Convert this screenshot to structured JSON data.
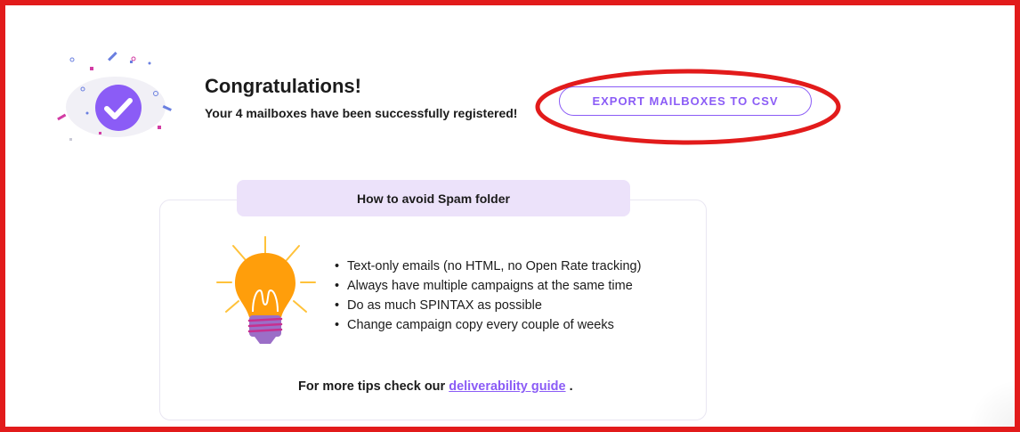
{
  "success": {
    "title": "Congratulations!",
    "subtitle": "Your 4 mailboxes have been successfully registered!",
    "icon": "check-circle-icon"
  },
  "export_button": {
    "label": "EXPORT MAILBOXES TO CSV"
  },
  "tips": {
    "heading": "How to avoid Spam folder",
    "icon": "lightbulb-icon",
    "items": [
      "Text-only emails (no HTML, no Open Rate tracking)",
      "Always have multiple campaigns at the same time",
      "Do as much SPINTAX as possible",
      "Change campaign copy every couple of weeks"
    ],
    "footer_prefix": "For more tips check our",
    "footer_link": "deliverability guide",
    "footer_suffix": "."
  },
  "colors": {
    "accent": "#8b5cf6",
    "annotation": "#e21b1b",
    "tab_bg": "#ece2fa",
    "bulb": "#ff9e0b"
  }
}
